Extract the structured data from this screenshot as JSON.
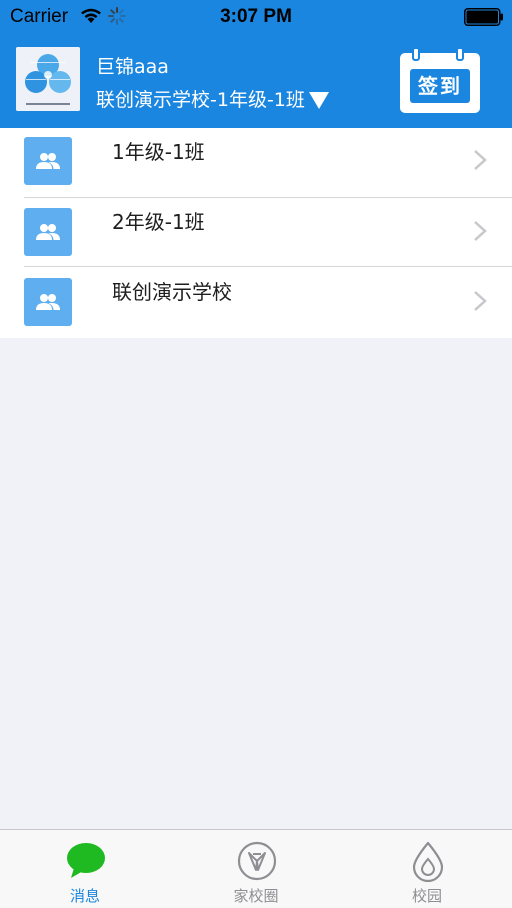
{
  "status_bar": {
    "carrier": "Carrier",
    "time": "3:07 PM"
  },
  "header": {
    "user_name": "巨锦aaa",
    "school_name": "联创演示学校-1年级-1班",
    "signin_label": "签到"
  },
  "groups": [
    {
      "label": "1年级-1班",
      "icon": "group-icon"
    },
    {
      "label": "2年级-1班",
      "icon": "group-icon"
    },
    {
      "label": "联创演示学校",
      "icon": "group-icon"
    }
  ],
  "tabs": [
    {
      "label": "消息",
      "icon": "chat-bubble-icon",
      "active": true
    },
    {
      "label": "家校圈",
      "icon": "compass-icon",
      "active": false
    },
    {
      "label": "校园",
      "icon": "water-drop-icon",
      "active": false
    }
  ],
  "colors": {
    "accent": "#1b86df",
    "active_tab_icon": "#1fb921",
    "group_icon_bg": "#5eaef0",
    "background": "#f1f2f7"
  }
}
